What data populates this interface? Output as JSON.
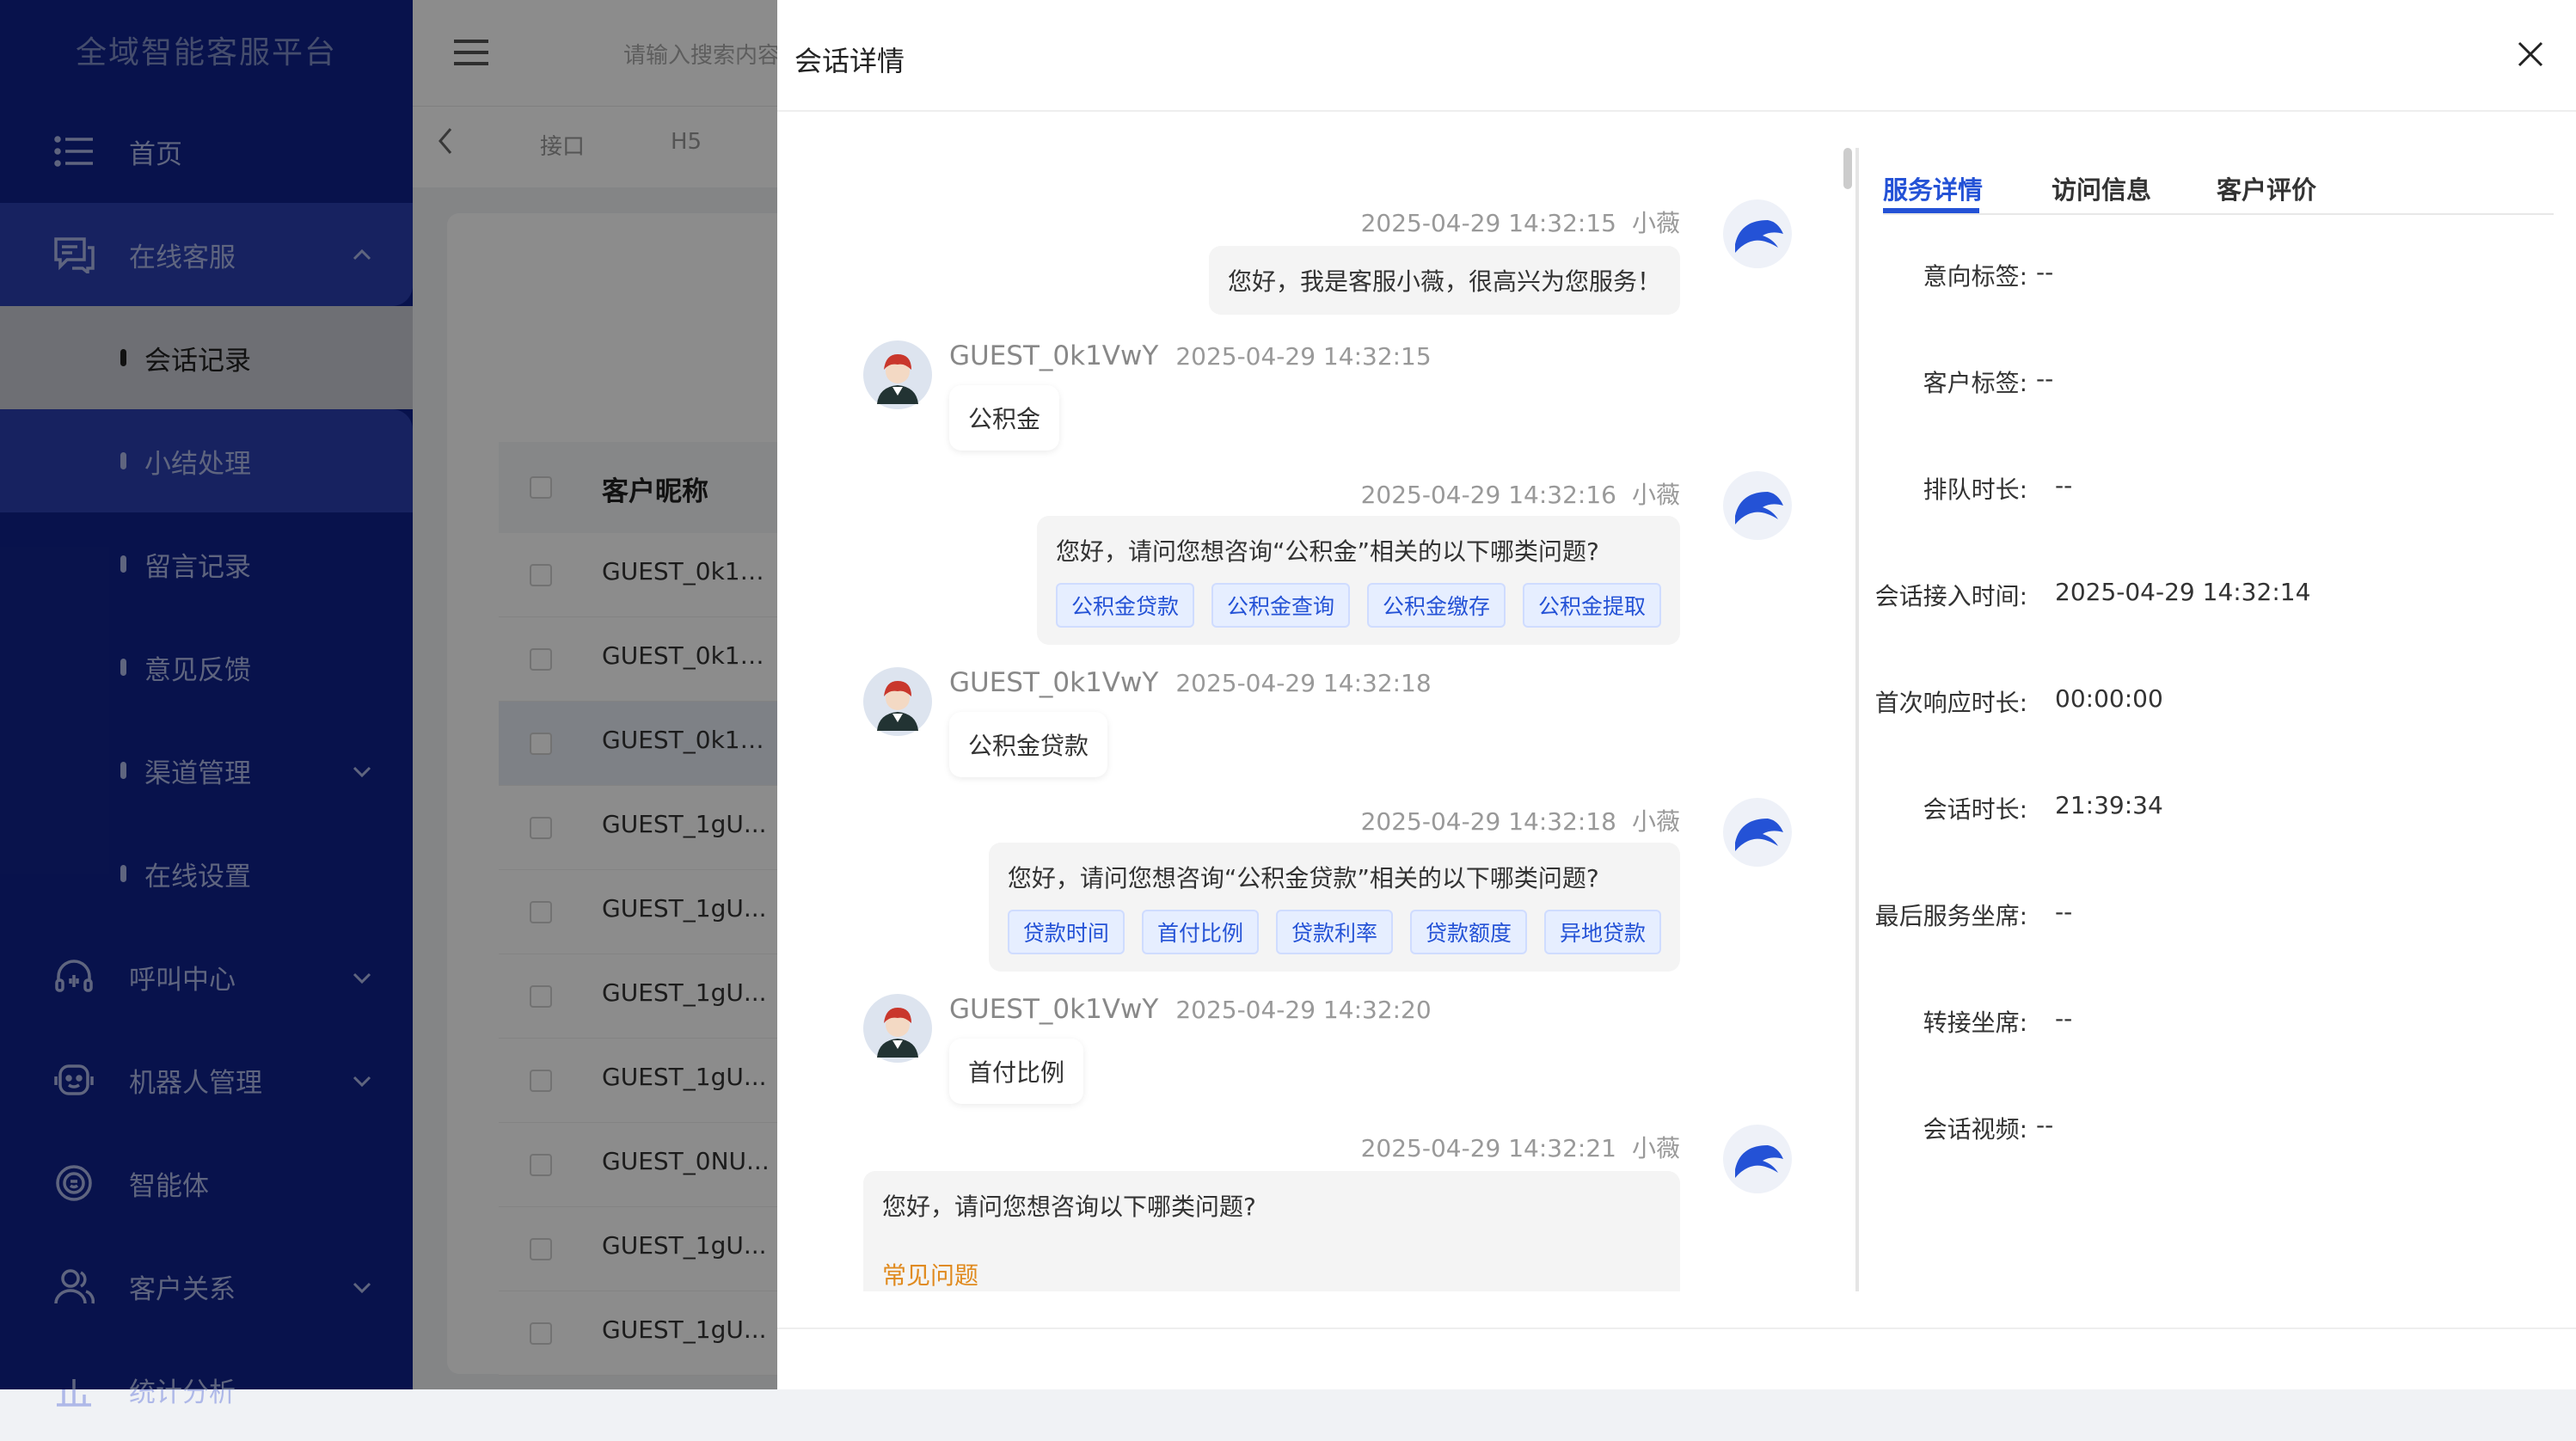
{
  "app": {
    "title": "全域智能客服平台"
  },
  "sidebar": {
    "items": [
      {
        "label": "首页",
        "icon": "list-icon"
      },
      {
        "label": "在线客服",
        "icon": "chat-icon"
      },
      {
        "label": "会话记录"
      },
      {
        "label": "小结处理"
      },
      {
        "label": "留言记录"
      },
      {
        "label": "意见反馈"
      },
      {
        "label": "渠道管理"
      },
      {
        "label": "在线设置"
      },
      {
        "label": "呼叫中心",
        "icon": "headset-icon"
      },
      {
        "label": "机器人管理",
        "icon": "robot-icon"
      },
      {
        "label": "智能体",
        "icon": "agent-icon"
      },
      {
        "label": "客户关系",
        "icon": "user-icon"
      },
      {
        "label": "统计分析",
        "icon": "chart-icon"
      }
    ]
  },
  "topbar": {
    "search_placeholder": "请输入搜索内容"
  },
  "tabs": [
    "接口",
    "H5"
  ],
  "table": {
    "header": "客户昵称",
    "rows": [
      "GUEST_0k1V...",
      "GUEST_0k1V...",
      "GUEST_0k1V...",
      "GUEST_1gU...",
      "GUEST_1gU...",
      "GUEST_1gU...",
      "GUEST_1gU...",
      "GUEST_0NU...",
      "GUEST_1gU...",
      "GUEST_1gU..."
    ]
  },
  "drawer": {
    "title": "会话详情",
    "messages": [
      {
        "from": "bot",
        "time": "2025-04-29 14:32:15",
        "name": "小薇",
        "text": "您好，我是客服小薇，很高兴为您服务！"
      },
      {
        "from": "guest",
        "name": "GUEST_0k1VwY",
        "time": "2025-04-29 14:32:15",
        "text": "公积金"
      },
      {
        "from": "bot",
        "time": "2025-04-29 14:32:16",
        "name": "小薇",
        "text": "您好，请问您想咨询“公积金”相关的以下哪类问题?",
        "options": [
          "公积金贷款",
          "公积金查询",
          "公积金缴存",
          "公积金提取"
        ]
      },
      {
        "from": "guest",
        "name": "GUEST_0k1VwY",
        "time": "2025-04-29 14:32:18",
        "text": "公积金贷款"
      },
      {
        "from": "bot",
        "time": "2025-04-29 14:32:18",
        "name": "小薇",
        "text": "您好，请问您想咨询“公积金贷款”相关的以下哪类问题?",
        "options": [
          "贷款时间",
          "首付比例",
          "贷款利率",
          "贷款额度",
          "异地贷款"
        ]
      },
      {
        "from": "guest",
        "name": "GUEST_0k1VwY",
        "time": "2025-04-29 14:32:20",
        "text": "首付比例"
      },
      {
        "from": "bot",
        "time": "2025-04-29 14:32:21",
        "name": "小薇",
        "text": "您好，请问您想咨询以下哪类问题?",
        "link": "常见问题"
      }
    ],
    "panel": {
      "tabs": [
        "服务详情",
        "访问信息",
        "客户评价"
      ],
      "fields": [
        {
          "label": "意向标签:",
          "value": "--"
        },
        {
          "label": "客户标签:",
          "value": "--"
        },
        {
          "label": "排队时长:",
          "value": "--"
        },
        {
          "label": "会话接入时间:",
          "value": "2025-04-29 14:32:14"
        },
        {
          "label": "首次响应时长:",
          "value": "00:00:00"
        },
        {
          "label": "会话时长:",
          "value": "21:39:34"
        },
        {
          "label": "最后服务坐席:",
          "value": "--"
        },
        {
          "label": "转接坐席:",
          "value": "--"
        },
        {
          "label": "会话视频:",
          "value": "--"
        }
      ]
    }
  },
  "colors": {
    "sidebar": "#10228a",
    "accent": "#2452d6",
    "link": "#e08a1e"
  }
}
